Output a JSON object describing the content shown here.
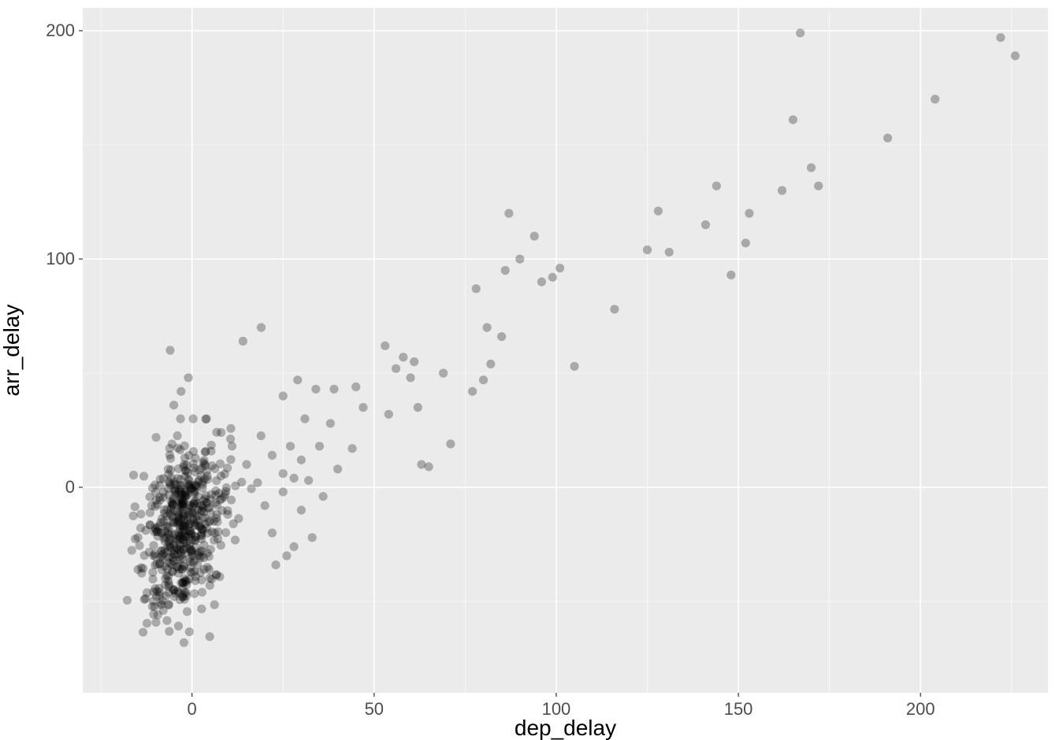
{
  "chart_data": {
    "type": "scatter",
    "xlabel": "dep_delay",
    "ylabel": "arr_delay",
    "xlim": [
      -30,
      235
    ],
    "ylim": [
      -90,
      210
    ],
    "x_ticks": [
      0,
      50,
      100,
      150,
      200
    ],
    "y_ticks": [
      0,
      100,
      200
    ],
    "x_minor": [
      -25,
      25,
      75,
      125,
      175,
      225
    ],
    "y_minor": [
      -50,
      50,
      150
    ],
    "point_radius": 5.6,
    "dense_cluster": {
      "n": 520,
      "x_center": -2,
      "x_spread": 6,
      "y_center": -18,
      "y_spread": 20,
      "x_min": -18,
      "x_max": 20,
      "y_min": -75,
      "y_max": 30
    },
    "outliers": [
      {
        "x": -6,
        "y": 60
      },
      {
        "x": 14,
        "y": 64
      },
      {
        "x": 19,
        "y": 70
      },
      {
        "x": -1,
        "y": 48
      },
      {
        "x": -3,
        "y": 42
      },
      {
        "x": -5,
        "y": 36
      },
      {
        "x": 4,
        "y": 30
      },
      {
        "x": 8,
        "y": 24
      },
      {
        "x": 11,
        "y": 18
      },
      {
        "x": 15,
        "y": 10
      },
      {
        "x": 18,
        "y": 2
      },
      {
        "x": 20,
        "y": -8
      },
      {
        "x": 22,
        "y": -20
      },
      {
        "x": 22,
        "y": 14
      },
      {
        "x": 23,
        "y": -34
      },
      {
        "x": 25,
        "y": -2
      },
      {
        "x": 25,
        "y": 6
      },
      {
        "x": 25,
        "y": 40
      },
      {
        "x": 26,
        "y": -30
      },
      {
        "x": 27,
        "y": 18
      },
      {
        "x": 28,
        "y": -26
      },
      {
        "x": 28,
        "y": 4
      },
      {
        "x": 29,
        "y": 47
      },
      {
        "x": 30,
        "y": -10
      },
      {
        "x": 30,
        "y": 12
      },
      {
        "x": 31,
        "y": 30
      },
      {
        "x": 32,
        "y": 3
      },
      {
        "x": 33,
        "y": -22
      },
      {
        "x": 34,
        "y": 43
      },
      {
        "x": 35,
        "y": 18
      },
      {
        "x": 36,
        "y": -4
      },
      {
        "x": 38,
        "y": 28
      },
      {
        "x": 39,
        "y": 43
      },
      {
        "x": 40,
        "y": 8
      },
      {
        "x": 44,
        "y": 17
      },
      {
        "x": 45,
        "y": 44
      },
      {
        "x": 47,
        "y": 35
      },
      {
        "x": 53,
        "y": 62
      },
      {
        "x": 54,
        "y": 32
      },
      {
        "x": 56,
        "y": 52
      },
      {
        "x": 58,
        "y": 57
      },
      {
        "x": 60,
        "y": 48
      },
      {
        "x": 61,
        "y": 55
      },
      {
        "x": 62,
        "y": 35
      },
      {
        "x": 63,
        "y": 10
      },
      {
        "x": 65,
        "y": 9
      },
      {
        "x": 69,
        "y": 50
      },
      {
        "x": 71,
        "y": 19
      },
      {
        "x": 77,
        "y": 42
      },
      {
        "x": 78,
        "y": 87
      },
      {
        "x": 80,
        "y": 47
      },
      {
        "x": 81,
        "y": 70
      },
      {
        "x": 82,
        "y": 54
      },
      {
        "x": 85,
        "y": 66
      },
      {
        "x": 86,
        "y": 95
      },
      {
        "x": 87,
        "y": 120
      },
      {
        "x": 90,
        "y": 100
      },
      {
        "x": 94,
        "y": 110
      },
      {
        "x": 96,
        "y": 90
      },
      {
        "x": 99,
        "y": 92
      },
      {
        "x": 101,
        "y": 96
      },
      {
        "x": 105,
        "y": 53
      },
      {
        "x": 116,
        "y": 78
      },
      {
        "x": 125,
        "y": 104
      },
      {
        "x": 128,
        "y": 121
      },
      {
        "x": 131,
        "y": 103
      },
      {
        "x": 141,
        "y": 115
      },
      {
        "x": 144,
        "y": 132
      },
      {
        "x": 148,
        "y": 93
      },
      {
        "x": 152,
        "y": 107
      },
      {
        "x": 153,
        "y": 120
      },
      {
        "x": 162,
        "y": 130
      },
      {
        "x": 165,
        "y": 161
      },
      {
        "x": 167,
        "y": 199
      },
      {
        "x": 170,
        "y": 140
      },
      {
        "x": 172,
        "y": 132
      },
      {
        "x": 191,
        "y": 153
      },
      {
        "x": 204,
        "y": 170
      },
      {
        "x": 222,
        "y": 197
      },
      {
        "x": 226,
        "y": 189
      }
    ]
  },
  "axis_tick_labels": {
    "x": [
      "0",
      "50",
      "100",
      "150",
      "200"
    ],
    "y": [
      "0",
      "100",
      "200"
    ]
  }
}
